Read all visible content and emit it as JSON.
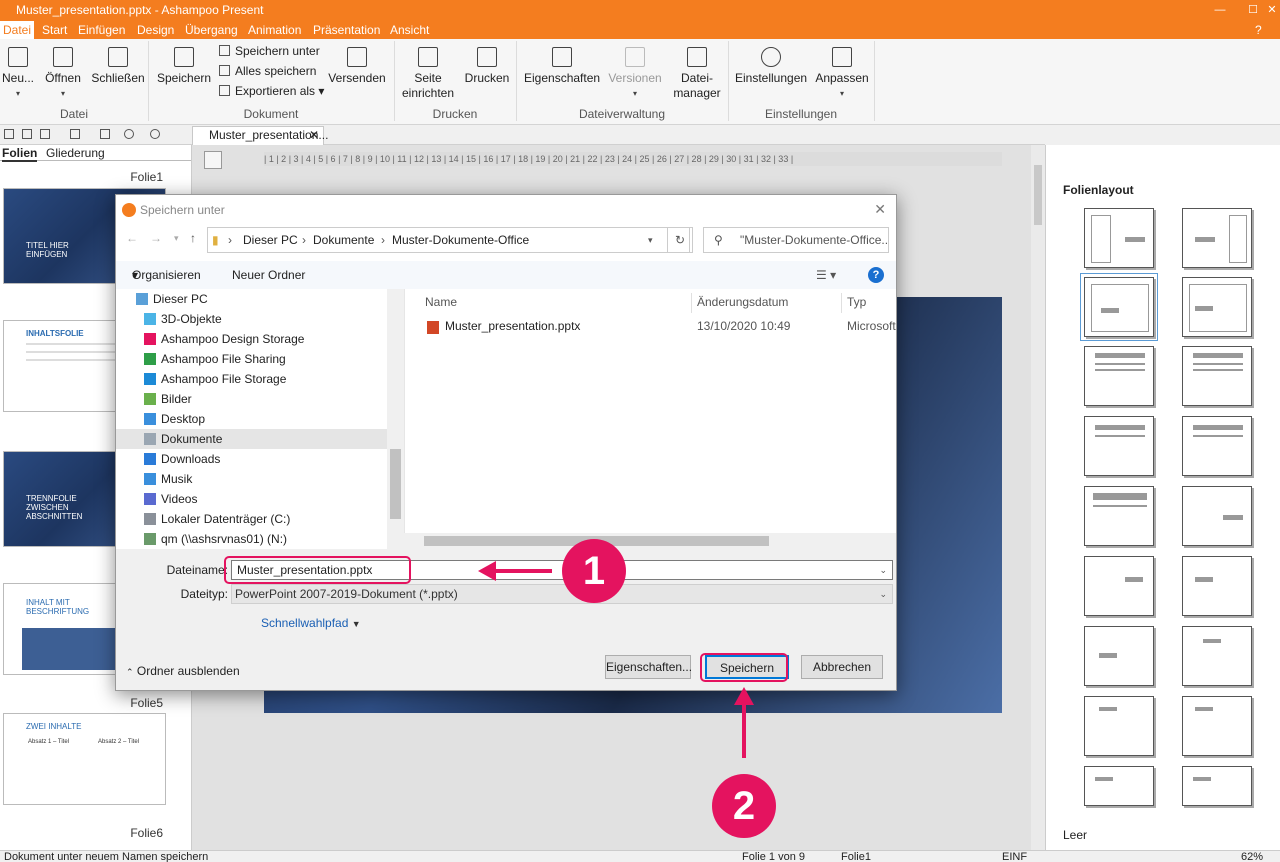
{
  "window": {
    "title": "Muster_presentation.pptx - Ashampoo Present"
  },
  "menu": [
    "Datei",
    "Start",
    "Einfügen",
    "Design",
    "Übergang",
    "Animation",
    "Präsentation",
    "Ansicht"
  ],
  "ribbon": {
    "neu": "Neu...",
    "oeffnen": "Öffnen",
    "schliessen": "Schließen",
    "speichern": "Speichern",
    "speichern_unter": "Speichern unter",
    "alles_speichern": "Alles speichern",
    "exportieren": "Exportieren als",
    "versenden": "Versenden",
    "seite_einrichten_1": "Seite",
    "seite_einrichten_2": "einrichten",
    "drucken": "Drucken",
    "eigenschaften": "Eigenschaften",
    "versionen": "Versionen",
    "dateimanager_1": "Datei-",
    "dateimanager_2": "manager",
    "einstellungen": "Einstellungen",
    "anpassen": "Anpassen",
    "groups": {
      "datei": "Datei",
      "dokument": "Dokument",
      "drucken": "Drucken",
      "dateiverwaltung": "Dateiverwaltung",
      "einstellungen": "Einstellungen"
    }
  },
  "doc_tab": {
    "label": "Muster_presentation..."
  },
  "left_pane": {
    "tab_folien": "Folien",
    "tab_gliederung": "Gliederung",
    "labels": {
      "folie1": "Folie1",
      "folie5": "Folie5",
      "folie6": "Folie6"
    },
    "thumbs": {
      "t1": "TITEL HIER EINFÜGEN",
      "t2": "INHALTSFOLIE",
      "t3": "TRENNFOLIE ZWISCHEN ABSCHNITTEN",
      "t4": "INHALT MIT BESCHRIFTUNG",
      "t5": "ZWEI INHALTE",
      "t5a": "Absatz 1 – Titel",
      "t5b": "Absatz 2 – Titel"
    }
  },
  "ruler": "| 1 | 2 | 3 | 4 | 5 | 6 | 7 | 8 | 9 | 10 | 11 | 12 | 13 | 14 | 15 | 16 | 17 | 18 | 19 | 20 | 21 | 22 | 23 | 24 | 25 | 26 | 27 | 28 | 29 | 30 | 31 | 32 | 33 |",
  "right_pane": {
    "title": "Folienlayout",
    "empty_label": "Leer"
  },
  "status": {
    "message": "Dokument unter neuem Namen speichern",
    "slide": "Folie 1 von 9",
    "name": "Folie1",
    "mode": "EINF",
    "zoom": "62%"
  },
  "dialog": {
    "title": "Speichern unter",
    "path": [
      "Dieser PC",
      "Dokumente",
      "Muster-Dokumente-Office"
    ],
    "search_placeholder": "\"Muster-Dokumente-Office...",
    "organize": "Organisieren",
    "new_folder": "Neuer Ordner",
    "tree": [
      "Dieser PC",
      "3D-Objekte",
      "Ashampoo Design Storage",
      "Ashampoo File Sharing",
      "Ashampoo File Storage",
      "Bilder",
      "Desktop",
      "Dokumente",
      "Downloads",
      "Musik",
      "Videos",
      "Lokaler Datenträger (C:)",
      "qm (\\\\ashsrvnas01) (N:)"
    ],
    "columns": {
      "name": "Name",
      "date": "Änderungsdatum",
      "type": "Typ"
    },
    "file": {
      "name": "Muster_presentation.pptx",
      "date": "13/10/2020 10:49",
      "type": "Microsoft"
    },
    "filename_label": "Dateiname:",
    "filename_value": "Muster_presentation.pptx",
    "filetype_label": "Dateityp:",
    "filetype_value": "PowerPoint 2007-2019-Dokument (*.pptx)",
    "quick_path": "Schnellwahlpfad",
    "hide_folders": "Ordner ausblenden",
    "btn_props": "Eigenschaften...",
    "btn_save": "Speichern",
    "btn_cancel": "Abbrechen"
  },
  "annotations": {
    "one": "1",
    "two": "2"
  },
  "colors": {
    "accent": "#f47d1f",
    "highlight": "#e4135f",
    "link": "#1a5fb4"
  }
}
